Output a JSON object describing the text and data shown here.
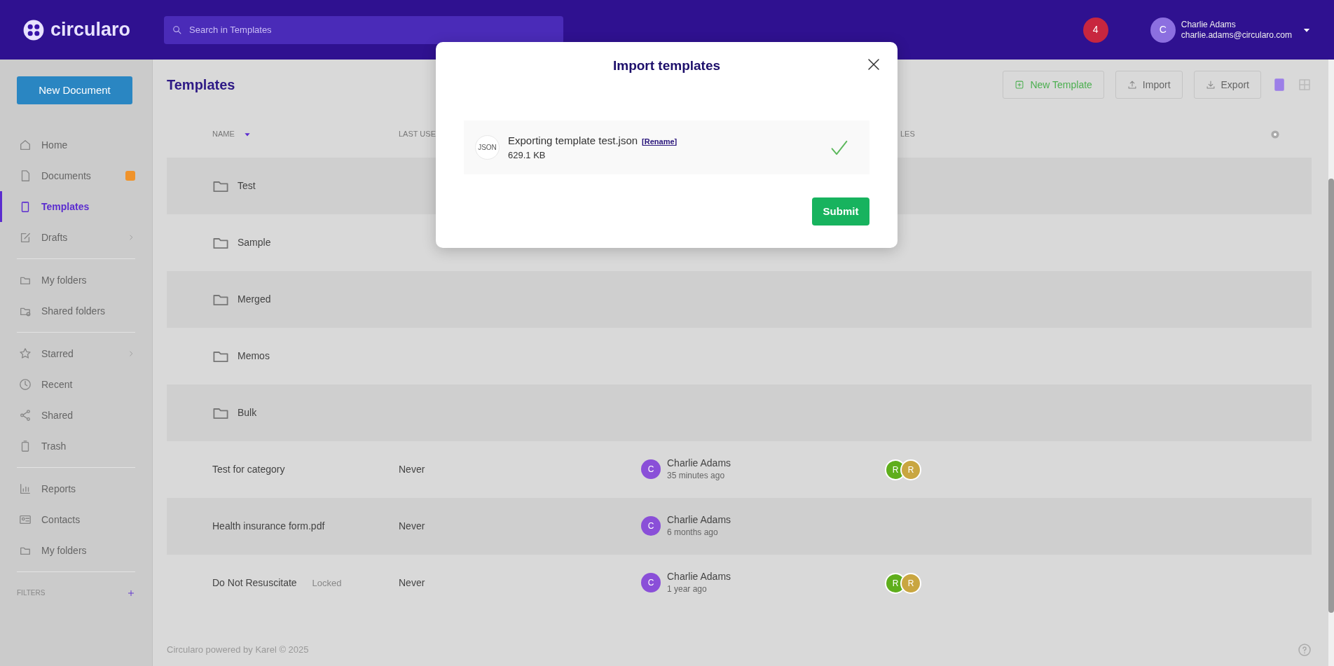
{
  "header": {
    "logo": "circularo",
    "search": {
      "placeholder": "Search in Templates"
    },
    "notifications": "4",
    "user": {
      "initial": "C",
      "name": "Charlie Adams",
      "email": "charlie.adams@circularo.com"
    }
  },
  "sidebar": {
    "new_button": "New Document",
    "groups": [
      [
        {
          "label": "Home",
          "kind": "plain",
          "selected": false
        },
        {
          "label": "Documents",
          "kind": "badge",
          "selected": false
        },
        {
          "label": "Templates",
          "kind": "plain",
          "selected": true
        },
        {
          "label": "Drafts",
          "kind": "expand",
          "selected": false
        }
      ],
      [
        {
          "label": "My folders",
          "kind": "plain",
          "selected": false
        },
        {
          "label": "Shared folders",
          "kind": "plain",
          "selected": false
        }
      ],
      [
        {
          "label": "Starred",
          "kind": "expand",
          "selected": false
        },
        {
          "label": "Recent",
          "kind": "plain",
          "selected": false
        },
        {
          "label": "Shared",
          "kind": "plain",
          "selected": false
        },
        {
          "label": "Trash",
          "kind": "plain",
          "selected": false
        }
      ],
      [
        {
          "label": "Reports",
          "kind": "plain",
          "selected": false
        },
        {
          "label": "Contacts",
          "kind": "plain",
          "selected": false
        },
        {
          "label": "My folders",
          "kind": "plain",
          "selected": false
        }
      ]
    ],
    "filters": "FILTERS"
  },
  "page": {
    "title": "Templates",
    "buttons": [
      "New Template",
      "Import",
      "Export"
    ],
    "views": [
      {
        "selected": true
      },
      {
        "selected": false
      }
    ]
  },
  "table": {
    "columns": [
      "NAME",
      "LAST USE",
      "LES"
    ],
    "rows": [
      {
        "kind": "folder",
        "name": "Test"
      },
      {
        "kind": "folder",
        "name": "Sample"
      },
      {
        "kind": "folder",
        "name": "Merged"
      },
      {
        "kind": "folder",
        "name": "Memos"
      },
      {
        "kind": "folder",
        "name": "Bulk"
      },
      {
        "kind": "file",
        "name": "Test for category",
        "last_used": "Never",
        "owner": {
          "initial": "C",
          "name": "Charlie Adams",
          "time": "35 minutes ago"
        },
        "roles": [
          {
            "initial": "R",
            "color": "#5fae1c"
          },
          {
            "initial": "R",
            "color": "#c9a640"
          }
        ]
      },
      {
        "kind": "file",
        "name": "Health insurance form.pdf",
        "last_used": "Never",
        "owner": {
          "initial": "C",
          "name": "Charlie Adams",
          "time": "6 months ago"
        }
      },
      {
        "kind": "file",
        "name": "Do Not Resuscitate",
        "tag": "Locked",
        "last_used": "Never",
        "owner": {
          "initial": "C",
          "name": "Charlie Adams",
          "time": "1 year ago"
        },
        "roles": [
          {
            "initial": "R",
            "color": "#5fae1c"
          },
          {
            "initial": "R",
            "color": "#c9a640"
          }
        ]
      }
    ]
  },
  "footer": "Circularo powered by Karel © 2025",
  "modal": {
    "title": "Import templates",
    "file": {
      "type": "JSON",
      "name": "Exporting template test.json",
      "rename": "[Rename]",
      "size": "629.1 KB",
      "done": true
    },
    "submit": "Submit"
  }
}
